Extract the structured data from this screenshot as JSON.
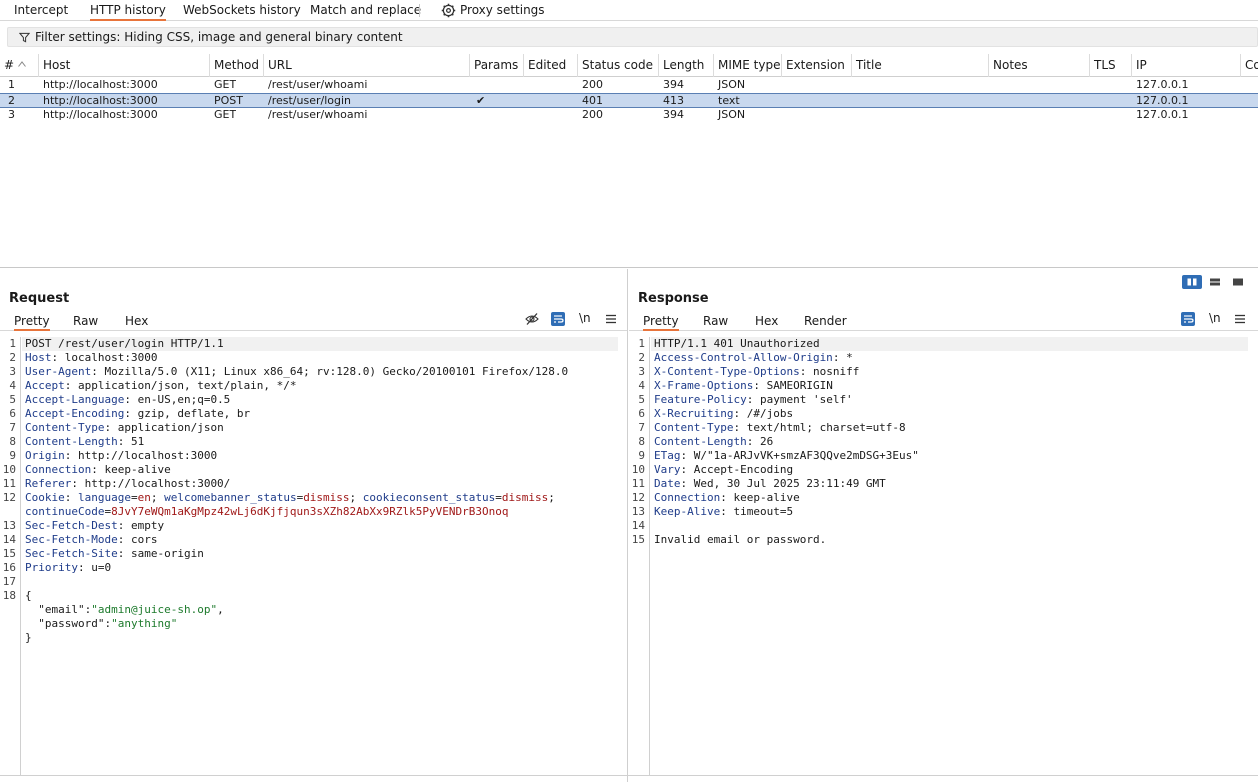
{
  "top_tabs": [
    "Intercept",
    "HTTP history",
    "WebSockets history",
    "Match and replace",
    "Proxy settings"
  ],
  "filter": {
    "text": "Filter settings: Hiding CSS, image and general binary content"
  },
  "table": {
    "columns": [
      "#",
      "Host",
      "Method",
      "URL",
      "Params",
      "Edited",
      "Status code",
      "Length",
      "MIME type",
      "Extension",
      "Title",
      "Notes",
      "TLS",
      "IP",
      "Co"
    ],
    "rows": [
      {
        "num": "1",
        "host": "http://localhost:3000",
        "method": "GET",
        "url": "/rest/user/whoami",
        "params": "",
        "status": "200",
        "length": "394",
        "mime": "JSON",
        "ip": "127.0.0.1"
      },
      {
        "num": "2",
        "host": "http://localhost:3000",
        "method": "POST",
        "url": "/rest/user/login",
        "params": "✔",
        "status": "401",
        "length": "413",
        "mime": "text",
        "ip": "127.0.0.1"
      },
      {
        "num": "3",
        "host": "http://localhost:3000",
        "method": "GET",
        "url": "/rest/user/whoami",
        "params": "",
        "status": "200",
        "length": "394",
        "mime": "JSON",
        "ip": "127.0.0.1"
      }
    ]
  },
  "request": {
    "title": "Request",
    "tabs": [
      "Pretty",
      "Raw",
      "Hex"
    ],
    "newline_label": "\\n",
    "line_numbers": [
      "1",
      "2",
      "3",
      "4",
      "5",
      "6",
      "7",
      "8",
      "9",
      "10",
      "11",
      "12",
      "13",
      "14",
      "15",
      "16",
      "17",
      "18"
    ],
    "request_line": "POST /rest/user/login HTTP/1.1",
    "headers": [
      {
        "name": "Host",
        "value": "localhost:3000"
      },
      {
        "name": "User-Agent",
        "value": "Mozilla/5.0 (X11; Linux x86_64; rv:128.0) Gecko/20100101 Firefox/128.0"
      },
      {
        "name": "Accept",
        "value": "application/json, text/plain, */*"
      },
      {
        "name": "Accept-Language",
        "value": "en-US,en;q=0.5"
      },
      {
        "name": "Accept-Encoding",
        "value": "gzip, deflate, br"
      },
      {
        "name": "Content-Type",
        "value": "application/json"
      },
      {
        "name": "Content-Length",
        "value": "51"
      },
      {
        "name": "Origin",
        "value": "http://localhost:3000"
      },
      {
        "name": "Connection",
        "value": "keep-alive"
      },
      {
        "name": "Referer",
        "value": "http://localhost:3000/"
      }
    ],
    "cookie": {
      "name": "Cookie",
      "c1_name": "language",
      "c1_value": "en",
      "c2_name": "welcomebanner_status",
      "c2_value": "dismiss",
      "c3_name": "cookieconsent_status",
      "c3_value": "dismiss",
      "c4_name": "continueCode",
      "c4_value": "8JvY7eWQm1aKgMpz42wLj6dKjfjqun3sXZh82AbXx9RZlk5PyVENDrB3Onoq"
    },
    "headers2": [
      {
        "name": "Sec-Fetch-Dest",
        "value": "empty"
      },
      {
        "name": "Sec-Fetch-Mode",
        "value": "cors"
      },
      {
        "name": "Sec-Fetch-Site",
        "value": "same-origin"
      },
      {
        "name": "Priority",
        "value": "u=0"
      }
    ],
    "body": {
      "open": "{",
      "email_key": "\"email\"",
      "email_value": "\"admin@juice-sh.op\"",
      "password_key": "\"password\"",
      "password_value": "\"anything\"",
      "close": "}"
    }
  },
  "response": {
    "title": "Response",
    "tabs": [
      "Pretty",
      "Raw",
      "Hex",
      "Render"
    ],
    "newline_label": "\\n",
    "line_numbers": [
      "1",
      "2",
      "3",
      "4",
      "5",
      "6",
      "7",
      "8",
      "9",
      "10",
      "11",
      "12",
      "13",
      "14",
      "15"
    ],
    "status_line": "HTTP/1.1 401 Unauthorized",
    "headers": [
      {
        "name": "Access-Control-Allow-Origin",
        "value": "*"
      },
      {
        "name": "X-Content-Type-Options",
        "value": "nosniff"
      },
      {
        "name": "X-Frame-Options",
        "value": "SAMEORIGIN"
      },
      {
        "name": "Feature-Policy",
        "value": "payment 'self'"
      },
      {
        "name": "X-Recruiting",
        "value": "/#/jobs"
      },
      {
        "name": "Content-Type",
        "value": "text/html; charset=utf-8"
      },
      {
        "name": "Content-Length",
        "value": "26"
      },
      {
        "name": "ETag",
        "value": "W/\"1a-ARJvVK+smzAF3QQve2mDSG+3Eus\""
      },
      {
        "name": "Vary",
        "value": "Accept-Encoding"
      },
      {
        "name": "Date",
        "value": "Wed, 30 Jul 2025 23:11:49 GMT"
      },
      {
        "name": "Connection",
        "value": "keep-alive"
      },
      {
        "name": "Keep-Alive",
        "value": "timeout=5"
      }
    ],
    "body": "Invalid email or password."
  },
  "colors": {
    "accent": "#e8743b",
    "selected_row": "#c8d8ee",
    "header_key": "#1f3c8a",
    "json_string": "#1d7a2c",
    "cookie_value": "#a01818",
    "layout_active": "#2f6db5"
  }
}
